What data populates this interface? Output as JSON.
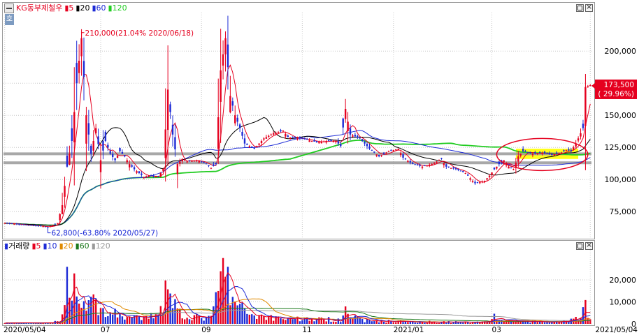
{
  "price_pane": {
    "title": "KG동부제철우",
    "ma_labels": [
      {
        "label": "5",
        "color": "#e5001f"
      },
      {
        "label": "20",
        "color": "#000000"
      },
      {
        "label": "60",
        "color": "#1d2bd6"
      },
      {
        "label": "120",
        "color": "#22cc22"
      }
    ],
    "side_tab": "호"
  },
  "volume_pane": {
    "title": "거래량",
    "ma_labels": [
      {
        "label": "5",
        "color": "#e5001f"
      },
      {
        "label": "10",
        "color": "#1d2bd6"
      },
      {
        "label": "20",
        "color": "#e08a00"
      },
      {
        "label": "60",
        "color": "#1d7a1d"
      },
      {
        "label": "120",
        "color": "#9a9a9a"
      }
    ]
  },
  "colors": {
    "up": "#e5001f",
    "down": "#1d2bd6",
    "ma5": "#e5001f",
    "ma20": "#000000",
    "ma60": "#1d2bd6",
    "ma120": "#22cc22",
    "hline": "#9a9a9a",
    "highlight": "#ffff00",
    "ellipse": "#e5001f",
    "grid": "#c8c8c8"
  },
  "chart_data": {
    "type": "candlestick",
    "x_ticks": [
      "2020/05/04",
      "07",
      "09",
      "11",
      "2021/01",
      "03",
      "2021/05/04"
    ],
    "price_axis": {
      "ticks": [
        "75,000",
        "100,000",
        "125,000",
        "150,000",
        "175,000",
        "200,000"
      ],
      "ylim": [
        55000,
        230000
      ]
    },
    "volume_axis": {
      "ticks": [
        "0",
        "10,000",
        "20,000"
      ],
      "ylim": [
        0,
        33000
      ]
    },
    "annotations": {
      "high": "210,000(21.04% 2020/06/18)",
      "low": "62,800(-63.80% 2020/05/27)",
      "last_price": "173,500",
      "last_change": "( 29.96%)"
    },
    "horizontal_lines": [
      120000,
      113000
    ],
    "highlight_zone": {
      "from_index": 213,
      "to_index": 239,
      "low": 116000,
      "high": 124000
    },
    "ellipse_zone": {
      "from_index": 205,
      "to_index": 243,
      "low": 107000,
      "high": 132000
    },
    "anchors": [
      [
        0,
        66000
      ],
      [
        8,
        64500
      ],
      [
        16,
        63500
      ],
      [
        18,
        62800
      ],
      [
        22,
        66000
      ],
      [
        24,
        80000
      ],
      [
        26,
        110000
      ],
      [
        28,
        130000
      ],
      [
        30,
        175000
      ],
      [
        32,
        210000
      ],
      [
        34,
        150000
      ],
      [
        36,
        120000
      ],
      [
        38,
        140000
      ],
      [
        40,
        115000
      ],
      [
        42,
        130000
      ],
      [
        44,
        120000
      ],
      [
        46,
        115000
      ],
      [
        48,
        122000
      ],
      [
        50,
        118000
      ],
      [
        52,
        112000
      ],
      [
        54,
        108000
      ],
      [
        56,
        105000
      ],
      [
        58,
        102000
      ],
      [
        60,
        103000
      ],
      [
        64,
        102000
      ],
      [
        66,
        108000
      ],
      [
        68,
        170000
      ],
      [
        70,
        135000
      ],
      [
        72,
        112000
      ],
      [
        74,
        116000
      ],
      [
        76,
        114000
      ],
      [
        80,
        115000
      ],
      [
        84,
        112000
      ],
      [
        86,
        109000
      ],
      [
        88,
        112000
      ],
      [
        90,
        185000
      ],
      [
        92,
        210000
      ],
      [
        94,
        165000
      ],
      [
        96,
        150000
      ],
      [
        98,
        140000
      ],
      [
        100,
        128000
      ],
      [
        104,
        124000
      ],
      [
        108,
        132000
      ],
      [
        112,
        136000
      ],
      [
        116,
        138000
      ],
      [
        118,
        133000
      ],
      [
        122,
        132000
      ],
      [
        126,
        131000
      ],
      [
        130,
        129000
      ],
      [
        134,
        130000
      ],
      [
        138,
        130000
      ],
      [
        140,
        126000
      ],
      [
        142,
        155000
      ],
      [
        144,
        135000
      ],
      [
        148,
        132000
      ],
      [
        152,
        124000
      ],
      [
        156,
        118000
      ],
      [
        160,
        122000
      ],
      [
        164,
        124000
      ],
      [
        166,
        117000
      ],
      [
        170,
        112000
      ],
      [
        174,
        110000
      ],
      [
        178,
        112000
      ],
      [
        182,
        116000
      ],
      [
        184,
        110000
      ],
      [
        188,
        108000
      ],
      [
        192,
        105000
      ],
      [
        196,
        97000
      ],
      [
        200,
        99000
      ],
      [
        202,
        103000
      ],
      [
        204,
        108000
      ],
      [
        206,
        112000
      ],
      [
        208,
        115000
      ],
      [
        210,
        110000
      ],
      [
        212,
        108000
      ],
      [
        214,
        118000
      ],
      [
        216,
        122000
      ],
      [
        220,
        120000
      ],
      [
        224,
        121000
      ],
      [
        228,
        119000
      ],
      [
        232,
        121000
      ],
      [
        234,
        123000
      ],
      [
        236,
        122000
      ],
      [
        238,
        128000
      ],
      [
        240,
        136000
      ],
      [
        241,
        140000
      ],
      [
        242,
        172000
      ],
      [
        244,
        173500
      ]
    ],
    "volume_anchors": [
      [
        0,
        400
      ],
      [
        20,
        400
      ],
      [
        24,
        3000
      ],
      [
        26,
        20000
      ],
      [
        28,
        21500
      ],
      [
        30,
        14000
      ],
      [
        32,
        8000
      ],
      [
        36,
        12000
      ],
      [
        40,
        6000
      ],
      [
        44,
        5000
      ],
      [
        48,
        4000
      ],
      [
        52,
        3000
      ],
      [
        56,
        2500
      ],
      [
        60,
        2500
      ],
      [
        66,
        8000
      ],
      [
        68,
        28000
      ],
      [
        70,
        10000
      ],
      [
        74,
        4000
      ],
      [
        80,
        3000
      ],
      [
        86,
        2500
      ],
      [
        90,
        20000
      ],
      [
        92,
        26500
      ],
      [
        94,
        12000
      ],
      [
        98,
        7000
      ],
      [
        104,
        4000
      ],
      [
        110,
        3000
      ],
      [
        120,
        2500
      ],
      [
        130,
        2000
      ],
      [
        140,
        2000
      ],
      [
        142,
        11000
      ],
      [
        144,
        3000
      ],
      [
        150,
        1500
      ],
      [
        160,
        1200
      ],
      [
        170,
        1000
      ],
      [
        180,
        900
      ],
      [
        190,
        800
      ],
      [
        200,
        900
      ],
      [
        204,
        3000
      ],
      [
        208,
        1500
      ],
      [
        220,
        900
      ],
      [
        232,
        800
      ],
      [
        240,
        2500
      ],
      [
        242,
        8000
      ],
      [
        244,
        3500
      ]
    ],
    "count": 245
  }
}
